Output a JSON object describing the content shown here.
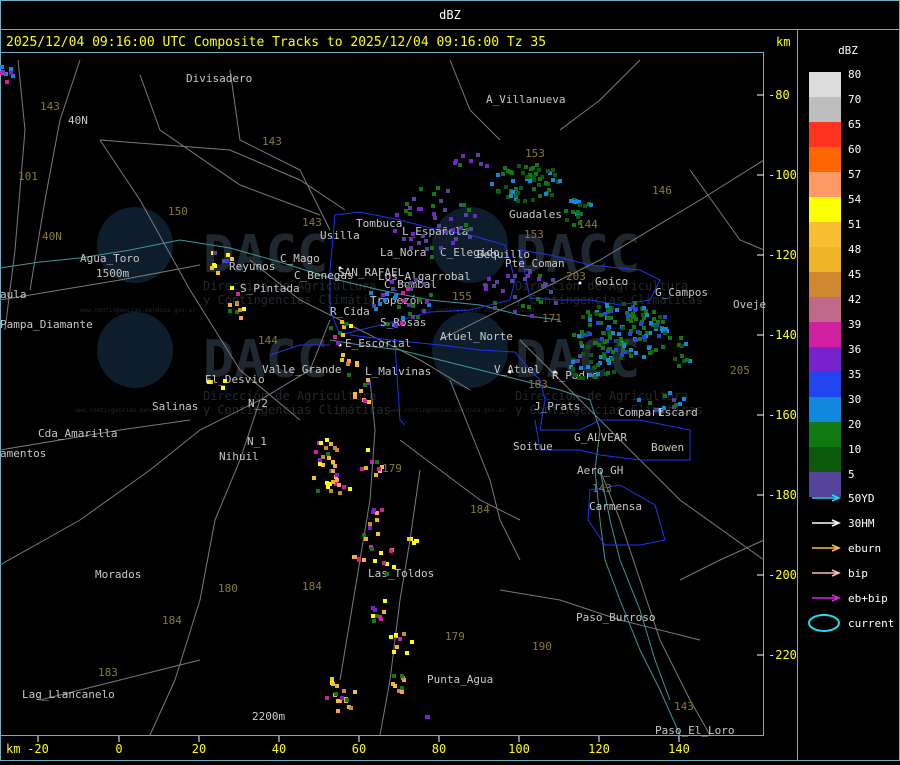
{
  "window_title": "dBZ",
  "header": {
    "title": "2025/12/04 09:16:00 UTC Composite Tracks to 2025/12/04 09:16:00 Tz 35",
    "unit": "km"
  },
  "axes": {
    "x_unit": "km",
    "y_unit": "km",
    "x_ticks": [
      "-20",
      "0",
      "20",
      "40",
      "60",
      "80",
      "100",
      "120",
      "140"
    ],
    "y_ticks": [
      "-80",
      "-100",
      "-120",
      "-140",
      "-160",
      "-180",
      "-200",
      "-220"
    ]
  },
  "legend": {
    "title": "dBZ",
    "levels": [
      {
        "label": "80",
        "color": "#dcdcdc"
      },
      {
        "label": "70",
        "color": "#bebebe"
      },
      {
        "label": "65",
        "color": "#ff3322"
      },
      {
        "label": "60",
        "color": "#ff6600"
      },
      {
        "label": "57",
        "color": "#ff9966"
      },
      {
        "label": "54",
        "color": "#ffff00"
      },
      {
        "label": "51",
        "color": "#f8c030"
      },
      {
        "label": "48",
        "color": "#f0b428"
      },
      {
        "label": "45",
        "color": "#d08830"
      },
      {
        "label": "42",
        "color": "#c06888"
      },
      {
        "label": "39",
        "color": "#d020a0"
      },
      {
        "label": "36",
        "color": "#7722cc"
      },
      {
        "label": "35",
        "color": "#2244ee"
      },
      {
        "label": "30",
        "color": "#1188dd"
      },
      {
        "label": "20",
        "color": "#117711"
      },
      {
        "label": "10",
        "color": "#0a5a0a"
      },
      {
        "label": "5",
        "color": "#554499"
      }
    ],
    "tracks": [
      {
        "label": "50YD",
        "color": "#22ddee"
      },
      {
        "label": "30HM",
        "color": "#ffffff"
      },
      {
        "label": "eburn",
        "color": "#ffbb44"
      },
      {
        "label": "bip",
        "color": "#ffbbbb"
      },
      {
        "label": "eb+bip",
        "color": "#dd22dd"
      }
    ],
    "current_label": "current",
    "current_color": "#22ddee"
  },
  "watermark": {
    "text": "DACC",
    "sub1": "Dirección de Agricultura",
    "sub2": "y Contingencias Climáticas",
    "url": "www.contingencias.mendoza.gov.ar"
  },
  "places": [
    "Divisadero",
    "A_Villanueva",
    "Guadales",
    "Usilla",
    "Tombuca",
    "L_Española",
    "La_Nora",
    "C_Elegido",
    "Bequillo",
    "Pte_Coman",
    "Goico",
    "G_Campos",
    "Oveje",
    "Agua_Toro",
    "Reyunos",
    "C_Mago",
    "C_Benegas",
    "SAN_RAFAEL",
    "Los_Algarrobal",
    "C_Bombal",
    "S_Pintada",
    "Tropezón",
    "Pampa_Diamante",
    "R_Cida",
    "S_Rosas",
    "Atuel_Norte",
    "E_Escorial",
    "El_Desvio",
    "Valle_Grande",
    "L_Malvinas",
    "V_Atuel",
    "R_Padre",
    "J_Prats",
    "Compart",
    "Escard",
    "Salinas",
    "N_2",
    "N_1",
    "Nihuil",
    "Cda_Amarilla",
    "amentos",
    "G_ALVEAR",
    "Soitue",
    "Bowen",
    "Aero_GH",
    "Carmensa",
    "Las_Toldos",
    "Morados",
    "Paso_Burroso",
    "Punta_Agua",
    "Lag_Llancanelo",
    "Paso_El_Loro",
    "aula",
    "2200m",
    "1500m",
    "40N"
  ],
  "route_labels": [
    "143",
    "101",
    "153",
    "40N",
    "150",
    "143",
    "153",
    "146",
    "155",
    "144",
    "203",
    "171",
    "144",
    "183",
    "205",
    "179",
    "184",
    "184",
    "180",
    "143",
    "143",
    "179",
    "190",
    "184",
    "183",
    "143"
  ],
  "echo_summary": "Scattered radar echoes (5-54 dBZ) from San Rafael south to Punta Agua; green/blue cluster near Goico and Guadales."
}
